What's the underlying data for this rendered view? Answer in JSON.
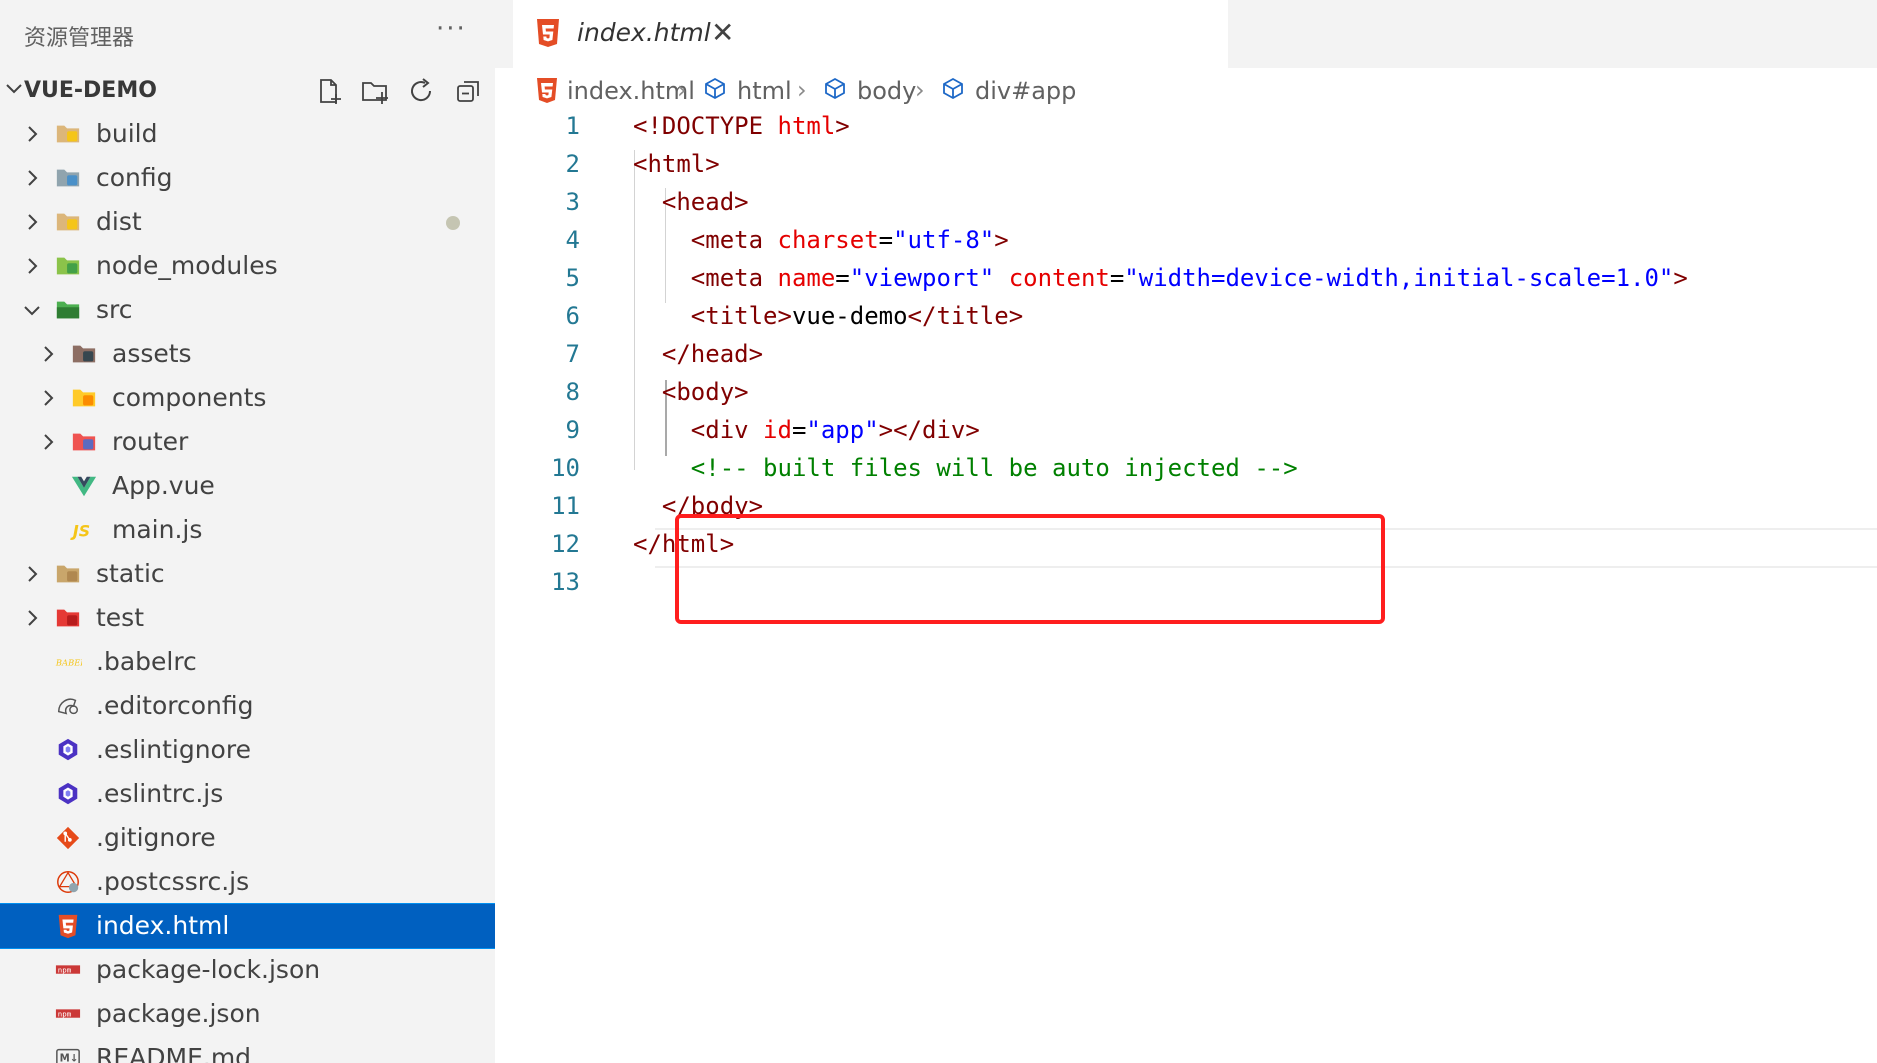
{
  "sidebar": {
    "title": "资源管理器",
    "more": "···",
    "project": "VUE-DEMO",
    "actions": [
      "new-file-icon",
      "new-folder-icon",
      "refresh-icon",
      "collapse-all-icon"
    ],
    "items": [
      {
        "label": "build",
        "icon": "folder-build-icon",
        "kind": "folder",
        "expanded": false,
        "depth": 0
      },
      {
        "label": "config",
        "icon": "folder-config-icon",
        "kind": "folder",
        "expanded": false,
        "depth": 0
      },
      {
        "label": "dist",
        "icon": "folder-dist-icon",
        "kind": "folder",
        "expanded": false,
        "depth": 0,
        "modified": true
      },
      {
        "label": "node_modules",
        "icon": "folder-node-icon",
        "kind": "folder",
        "expanded": false,
        "depth": 0
      },
      {
        "label": "src",
        "icon": "folder-src-icon",
        "kind": "folder",
        "expanded": true,
        "depth": 0
      },
      {
        "label": "assets",
        "icon": "folder-assets-icon",
        "kind": "folder",
        "expanded": false,
        "depth": 1
      },
      {
        "label": "components",
        "icon": "folder-components-icon",
        "kind": "folder",
        "expanded": false,
        "depth": 1
      },
      {
        "label": "router",
        "icon": "folder-router-icon",
        "kind": "folder",
        "expanded": false,
        "depth": 1
      },
      {
        "label": "App.vue",
        "icon": "vue-icon",
        "kind": "file",
        "depth": 1
      },
      {
        "label": "main.js",
        "icon": "js-icon",
        "kind": "file",
        "depth": 1
      },
      {
        "label": "static",
        "icon": "folder-static-icon",
        "kind": "folder",
        "expanded": false,
        "depth": 0
      },
      {
        "label": "test",
        "icon": "folder-test-icon",
        "kind": "folder",
        "expanded": false,
        "depth": 0
      },
      {
        "label": ".babelrc",
        "icon": "babel-icon",
        "kind": "file",
        "depth": 0
      },
      {
        "label": ".editorconfig",
        "icon": "editorconfig-icon",
        "kind": "file",
        "depth": 0
      },
      {
        "label": ".eslintignore",
        "icon": "eslint-icon",
        "kind": "file",
        "depth": 0
      },
      {
        "label": ".eslintrc.js",
        "icon": "eslint-icon",
        "kind": "file",
        "depth": 0
      },
      {
        "label": ".gitignore",
        "icon": "git-icon",
        "kind": "file",
        "depth": 0
      },
      {
        "label": ".postcssrc.js",
        "icon": "postcss-icon",
        "kind": "file",
        "depth": 0
      },
      {
        "label": "index.html",
        "icon": "html5-icon",
        "kind": "file",
        "depth": 0,
        "selected": true
      },
      {
        "label": "package-lock.json",
        "icon": "npm-icon",
        "kind": "file",
        "depth": 0
      },
      {
        "label": "package.json",
        "icon": "npm-icon",
        "kind": "file",
        "depth": 0
      },
      {
        "label": "README.md",
        "icon": "markdown-icon",
        "kind": "file",
        "depth": 0
      }
    ]
  },
  "editor": {
    "tab": {
      "label": "index.html",
      "icon": "html5-icon",
      "close": "✕"
    },
    "breadcrumb": [
      {
        "label": "index.html",
        "icon": "html5-icon"
      },
      {
        "label": "html",
        "icon": "cube-icon"
      },
      {
        "label": "body",
        "icon": "cube-icon"
      },
      {
        "label": "div#app",
        "icon": "cube-icon"
      }
    ],
    "breadcrumb_separator": "›",
    "lines": [
      {
        "num": "1",
        "tokens": [
          {
            "t": "<!DOCTYPE ",
            "c": "tag"
          },
          {
            "t": "html",
            "c": "attr"
          },
          {
            "t": ">",
            "c": "tag"
          }
        ]
      },
      {
        "num": "2",
        "tokens": [
          {
            "t": "<html>",
            "c": "tag"
          }
        ]
      },
      {
        "num": "3",
        "tokens": [
          {
            "t": "  <head>",
            "c": "tag"
          }
        ]
      },
      {
        "num": "4",
        "tokens": [
          {
            "t": "    <meta ",
            "c": "tag"
          },
          {
            "t": "charset",
            "c": "attr"
          },
          {
            "t": "=",
            "c": "text"
          },
          {
            "t": "\"utf-8\"",
            "c": "val"
          },
          {
            "t": ">",
            "c": "tag"
          }
        ]
      },
      {
        "num": "5",
        "tokens": [
          {
            "t": "    <meta ",
            "c": "tag"
          },
          {
            "t": "name",
            "c": "attr"
          },
          {
            "t": "=",
            "c": "text"
          },
          {
            "t": "\"viewport\"",
            "c": "val"
          },
          {
            "t": " content",
            "c": "attr"
          },
          {
            "t": "=",
            "c": "text"
          },
          {
            "t": "\"width=device-width,initial-scale=1.0\"",
            "c": "val"
          },
          {
            "t": ">",
            "c": "tag"
          }
        ]
      },
      {
        "num": "6",
        "tokens": [
          {
            "t": "    <title>",
            "c": "tag"
          },
          {
            "t": "vue-demo",
            "c": "text"
          },
          {
            "t": "</title>",
            "c": "tag"
          }
        ]
      },
      {
        "num": "7",
        "tokens": [
          {
            "t": "  </head>",
            "c": "tag"
          }
        ]
      },
      {
        "num": "8",
        "tokens": [
          {
            "t": "  <body>",
            "c": "tag"
          }
        ]
      },
      {
        "num": "9",
        "tokens": [
          {
            "t": "    <div ",
            "c": "tag"
          },
          {
            "t": "id",
            "c": "attr"
          },
          {
            "t": "=",
            "c": "text"
          },
          {
            "t": "\"app\"",
            "c": "val"
          },
          {
            "t": "></div>",
            "c": "tag"
          }
        ]
      },
      {
        "num": "10",
        "tokens": [
          {
            "t": "    <!-- built files will be auto injected -->",
            "c": "cmt"
          }
        ]
      },
      {
        "num": "11",
        "tokens": [
          {
            "t": "  </body>",
            "c": "tag"
          }
        ]
      },
      {
        "num": "12",
        "tokens": [
          {
            "t": "</html>",
            "c": "tag"
          }
        ]
      },
      {
        "num": "13",
        "tokens": []
      }
    ],
    "current_line": "9",
    "annotation_color": "#ff1e1e"
  },
  "colors": {
    "selection": "#0060c0",
    "tag": "#800000",
    "attr": "#e50000",
    "val": "#0000ff",
    "comment": "#008000",
    "line_number": "#237893"
  }
}
